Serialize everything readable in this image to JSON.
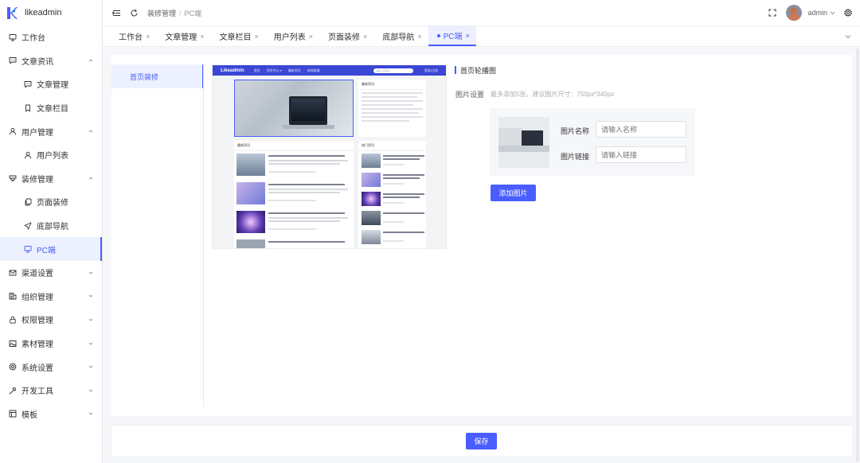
{
  "app": {
    "name": "likeadmin"
  },
  "sidebar": {
    "items": [
      {
        "label": "工作台",
        "icon": "monitor-icon",
        "level": 1
      },
      {
        "label": "文章资讯",
        "icon": "message-square-icon",
        "level": 1,
        "expandable": true,
        "expanded": true
      },
      {
        "label": "文章管理",
        "icon": "message-square-icon",
        "level": 2
      },
      {
        "label": "文章栏目",
        "icon": "bookmark-icon",
        "level": 2
      },
      {
        "label": "用户管理",
        "icon": "user-icon",
        "level": 1,
        "expandable": true,
        "expanded": true
      },
      {
        "label": "用户列表",
        "icon": "user-icon",
        "level": 2
      },
      {
        "label": "装修管理",
        "icon": "decorate-icon",
        "level": 1,
        "expandable": true,
        "expanded": true
      },
      {
        "label": "页面装修",
        "icon": "copy-icon",
        "level": 2
      },
      {
        "label": "底部导航",
        "icon": "send-icon",
        "level": 2
      },
      {
        "label": "PC端",
        "icon": "monitor-icon",
        "level": 2,
        "active": true
      },
      {
        "label": "渠道设置",
        "icon": "mail-icon",
        "level": 1,
        "expandable": true
      },
      {
        "label": "组织管理",
        "icon": "org-icon",
        "level": 1,
        "expandable": true
      },
      {
        "label": "权限管理",
        "icon": "lock-icon",
        "level": 1,
        "expandable": true
      },
      {
        "label": "素材管理",
        "icon": "image-icon",
        "level": 1,
        "expandable": true
      },
      {
        "label": "系统设置",
        "icon": "gear-icon",
        "level": 1,
        "expandable": true
      },
      {
        "label": "开发工具",
        "icon": "tool-icon",
        "level": 1,
        "expandable": true
      },
      {
        "label": "模板",
        "icon": "template-icon",
        "level": 1,
        "expandable": true
      }
    ]
  },
  "header": {
    "breadcrumb": [
      "装修管理",
      "PC端"
    ],
    "username": "admin"
  },
  "tabs": [
    {
      "label": "工作台",
      "active": false
    },
    {
      "label": "文章管理",
      "active": false
    },
    {
      "label": "文章栏目",
      "active": false
    },
    {
      "label": "用户列表",
      "active": false
    },
    {
      "label": "页面装修",
      "active": false
    },
    {
      "label": "底部导航",
      "active": false
    },
    {
      "label": "PC端",
      "active": true
    }
  ],
  "page_menu": {
    "items": [
      "首页装修"
    ]
  },
  "preview": {
    "brand": "Likeadmin",
    "nav_links": [
      "首页",
      "资讯中心 ▾",
      "最新资讯",
      "新闻报道"
    ],
    "search_placeholder": "请输入关键词",
    "login_text": "登录/注册",
    "latest_title": "最新资讯",
    "hot_title": "热门资讯",
    "recent_title": "最新资讯"
  },
  "settings": {
    "section_title": "首页轮播图",
    "field_label": "图片设置",
    "field_tip": "最多添加5张，建议图片尺寸：750px*340px",
    "name_label": "图片名称",
    "name_placeholder": "请输入名称",
    "link_label": "图片链接",
    "link_placeholder": "请输入链接",
    "add_button": "添加图片"
  },
  "footer": {
    "save_button": "保存"
  },
  "colors": {
    "accent": "#4a5dff",
    "active_bg": "#edf0fe",
    "preview_nav": "#3a47d5"
  }
}
